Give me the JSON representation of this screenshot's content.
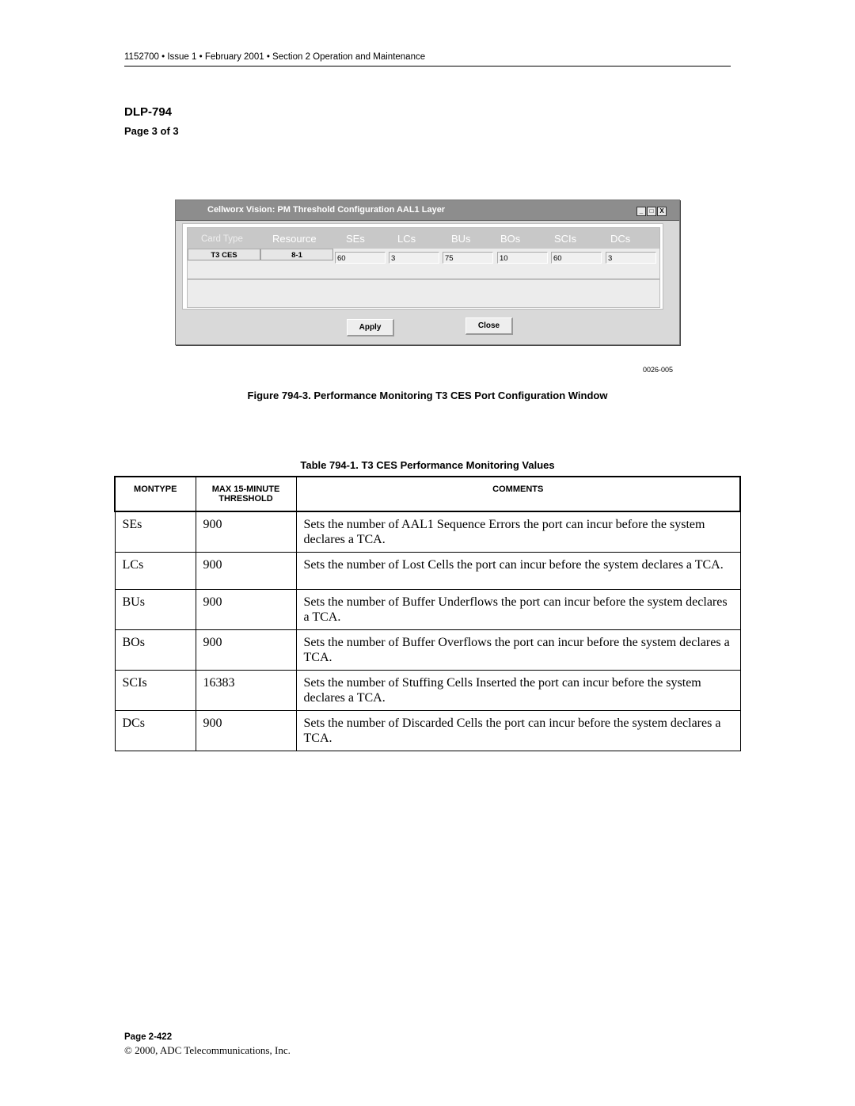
{
  "header": {
    "running_head": "1152700 • Issue 1 • February 2001 • Section 2 Operation and Maintenance",
    "dlp": "DLP-794",
    "page_of": "Page 3 of 3"
  },
  "window": {
    "title": "Cellworx Vision:   PM Threshold Configuration AAL1 Layer",
    "controls": {
      "minimize": "_",
      "maximize": "□",
      "close": "X"
    },
    "columns": [
      "Card Type",
      "Resource",
      "SEs",
      "LCs",
      "BUs",
      "BOs",
      "SCIs",
      "DCs"
    ],
    "row": {
      "card_type": "T3 CES",
      "resource": "8-1",
      "values": [
        "60",
        "3",
        "75",
        "10",
        "60",
        "3"
      ]
    },
    "buttons": {
      "apply": "Apply",
      "close": "Close"
    }
  },
  "figure": {
    "id": "0026-005",
    "caption": "Figure 794-3. Performance Monitoring T3 CES Port Configuration Window"
  },
  "table": {
    "caption": "Table 794-1. T3 CES Performance Monitoring Values",
    "headers": [
      "MONTYPE",
      "MAX 15-MINUTE THRESHOLD",
      "COMMENTS"
    ],
    "rows": [
      {
        "montype": "SEs",
        "threshold": "900",
        "comment": "Sets the number of AAL1 Sequence Errors the port can incur before the system declares a TCA."
      },
      {
        "montype": "LCs",
        "threshold": "900",
        "comment": "Sets the number of Lost Cells the port can incur before the system declares a TCA."
      },
      {
        "montype": "BUs",
        "threshold": "900",
        "comment": "Sets the number of Buffer Underflows the port can incur before the system declares a TCA."
      },
      {
        "montype": "BOs",
        "threshold": "900",
        "comment": "Sets the number of Buffer Overflows the port can incur before the system declares a TCA."
      },
      {
        "montype": "SCIs",
        "threshold": "16383",
        "comment": "Sets the number of Stuffing Cells Inserted the port can incur before the system declares a TCA."
      },
      {
        "montype": "DCs",
        "threshold": "900",
        "comment": "Sets the number of Discarded Cells the port can incur before the system declares a TCA."
      }
    ]
  },
  "footer": {
    "page": "Page 2-422",
    "copyright": "© 2000, ADC Telecommunications, Inc."
  }
}
